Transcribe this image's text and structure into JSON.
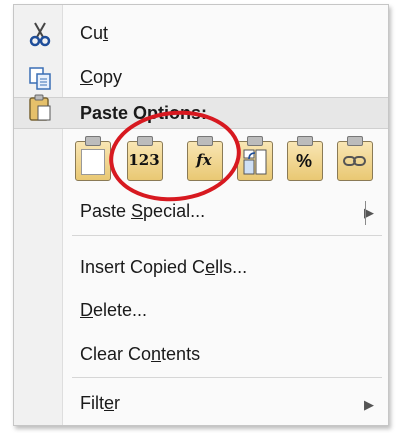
{
  "menu": {
    "cut": {
      "pre": "Cu",
      "key": "t",
      "post": ""
    },
    "copy": {
      "pre": "",
      "key": "C",
      "post": "opy"
    },
    "paste_options": "Paste Options:",
    "paste_icons": [
      {
        "name": "paste-icon",
        "text": ""
      },
      {
        "name": "paste-values-icon",
        "text": "123"
      },
      {
        "name": "paste-formulas-icon",
        "text": "fx"
      },
      {
        "name": "paste-transpose-icon",
        "text": ""
      },
      {
        "name": "paste-formatting-icon",
        "text": "%"
      },
      {
        "name": "paste-link-icon",
        "text": ""
      }
    ],
    "paste_special": {
      "pre": "Paste ",
      "key": "S",
      "post": "pecial..."
    },
    "insert_copied_cells": {
      "pre": "Insert Copied C",
      "key": "e",
      "post": "lls..."
    },
    "delete": {
      "pre": "",
      "key": "D",
      "post": "elete..."
    },
    "clear_contents": {
      "pre": "Clear Co",
      "key": "n",
      "post": "tents"
    },
    "filter": {
      "pre": "Filt",
      "key": "e",
      "post": "r"
    },
    "submenu_arrow": "▶"
  },
  "colors": {
    "highlight_circle": "#d71920",
    "header_bg": "#e7e7e7"
  }
}
